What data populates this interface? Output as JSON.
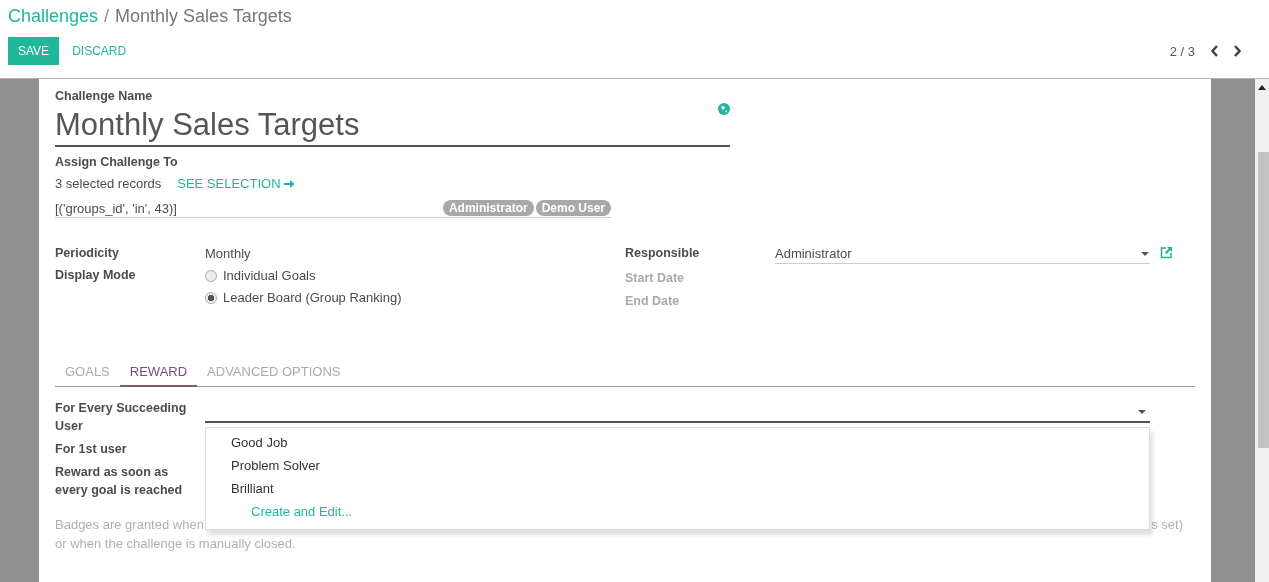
{
  "breadcrumb": {
    "parent": "Challenges",
    "separator": "/",
    "current": "Monthly Sales Targets"
  },
  "buttons": {
    "save": "SAVE",
    "discard": "DISCARD"
  },
  "pager": {
    "text": "2 / 3"
  },
  "form": {
    "name_label": "Challenge Name",
    "name": "Monthly Sales Targets",
    "assign_label": "Assign Challenge To",
    "selection_count": "3 selected records",
    "see_selection": "SEE SELECTION",
    "domain": "[('groups_id', 'in', 43)]",
    "tags": [
      "Administrator",
      "Demo User"
    ]
  },
  "left_fields": [
    {
      "label": "Periodicity",
      "kind": "text",
      "value": "Monthly"
    },
    {
      "label": "Display Mode",
      "kind": "radio",
      "options": [
        {
          "label": "Individual Goals",
          "selected": false
        },
        {
          "label": "Leader Board (Group Ranking)",
          "selected": true
        }
      ]
    }
  ],
  "right_fields": [
    {
      "label": "Responsible",
      "kind": "select",
      "value": "Administrator",
      "muted": false
    },
    {
      "label": "Start Date",
      "kind": "empty",
      "muted": true
    },
    {
      "label": "End Date",
      "kind": "empty",
      "muted": true
    }
  ],
  "tabs": [
    {
      "label": "GOALS",
      "selected": false
    },
    {
      "label": "REWARD",
      "selected": true
    },
    {
      "label": "ADVANCED OPTIONS",
      "selected": false
    }
  ],
  "reward_fields": [
    "For Every Succeeding User",
    "For 1st user",
    "Reward as soon as every goal is reached"
  ],
  "dropdown": {
    "options": [
      "Good Job",
      "Problem Solver",
      "Brilliant"
    ],
    "create": "Create and Edit..."
  },
  "help": {
    "line1_start": "Badges are granted when",
    "line1_end": "s set)",
    "line2": "or when the challenge is manually closed."
  }
}
